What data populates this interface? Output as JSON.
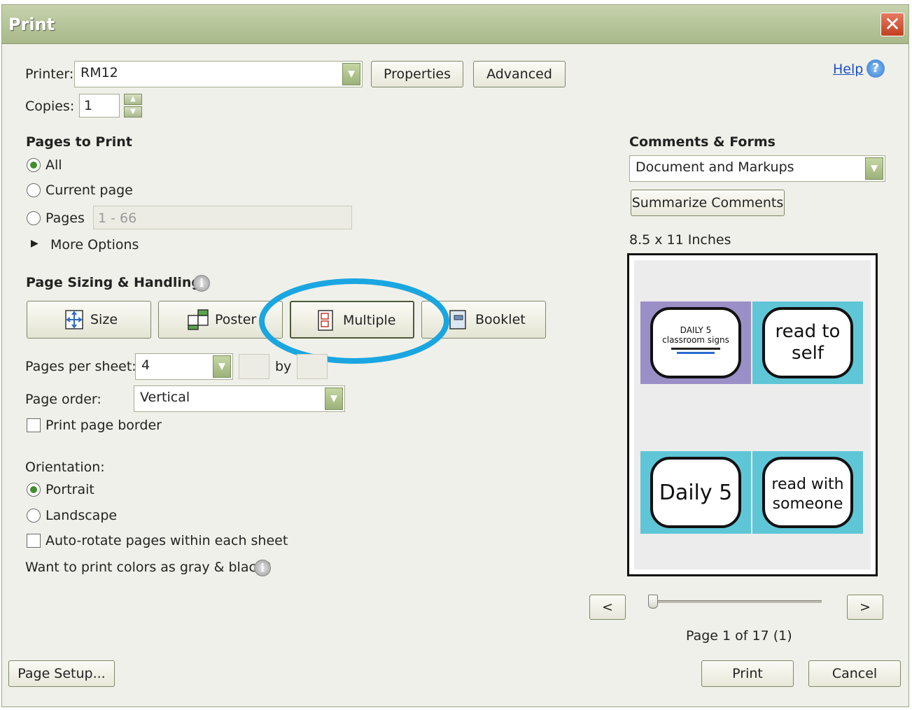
{
  "window": {
    "title": "Print",
    "close": "✕"
  },
  "printer": {
    "label": "Printer:",
    "value": "RM12",
    "properties": "Properties",
    "advanced": "Advanced"
  },
  "help": {
    "label": "Help",
    "icon": "?"
  },
  "copies": {
    "label": "Copies:",
    "value": "1"
  },
  "pages_to_print": {
    "heading": "Pages to Print",
    "all": "All",
    "current": "Current page",
    "pages": "Pages",
    "pages_range": "1 - 66",
    "more_options": "More Options",
    "selected": "all"
  },
  "sizing": {
    "heading": "Page Sizing & Handling",
    "size": "Size",
    "poster": "Poster",
    "multiple": "Multiple",
    "booklet": "Booklet",
    "selected": "multiple"
  },
  "multiple": {
    "pages_per_sheet_label": "Pages per sheet:",
    "pages_per_sheet": "4",
    "by": "by",
    "page_order_label": "Page order:",
    "page_order": "Vertical",
    "print_border": "Print page border",
    "print_border_checked": false
  },
  "orientation": {
    "label": "Orientation:",
    "portrait": "Portrait",
    "landscape": "Landscape",
    "selected": "portrait",
    "auto_rotate": "Auto-rotate pages within each sheet",
    "auto_rotate_checked": false
  },
  "gray": {
    "label": "Want to print colors as gray & black?"
  },
  "comments_forms": {
    "heading": "Comments & Forms",
    "value": "Document and Markups",
    "summarize": "Summarize Comments"
  },
  "preview": {
    "paper": "8.5 x 11 Inches",
    "tiles": [
      {
        "lines": [
          "DAILY 5",
          "classroom signs"
        ],
        "bg": "#9b8fc7"
      },
      {
        "lines": [
          "read to",
          "self"
        ],
        "bg": "#5ec6d6"
      },
      {
        "lines": [
          "Daily 5"
        ],
        "bg": "#5ec6d6"
      },
      {
        "lines": [
          "read with",
          "someone"
        ],
        "bg": "#5ec6d6"
      }
    ],
    "prev": "<",
    "next": ">",
    "page_status": "Page 1 of 17 (1)",
    "slider_fraction": 0.0
  },
  "footer": {
    "page_setup": "Page Setup...",
    "print": "Print",
    "cancel": "Cancel"
  },
  "highlight_color": "#1aa6e0"
}
